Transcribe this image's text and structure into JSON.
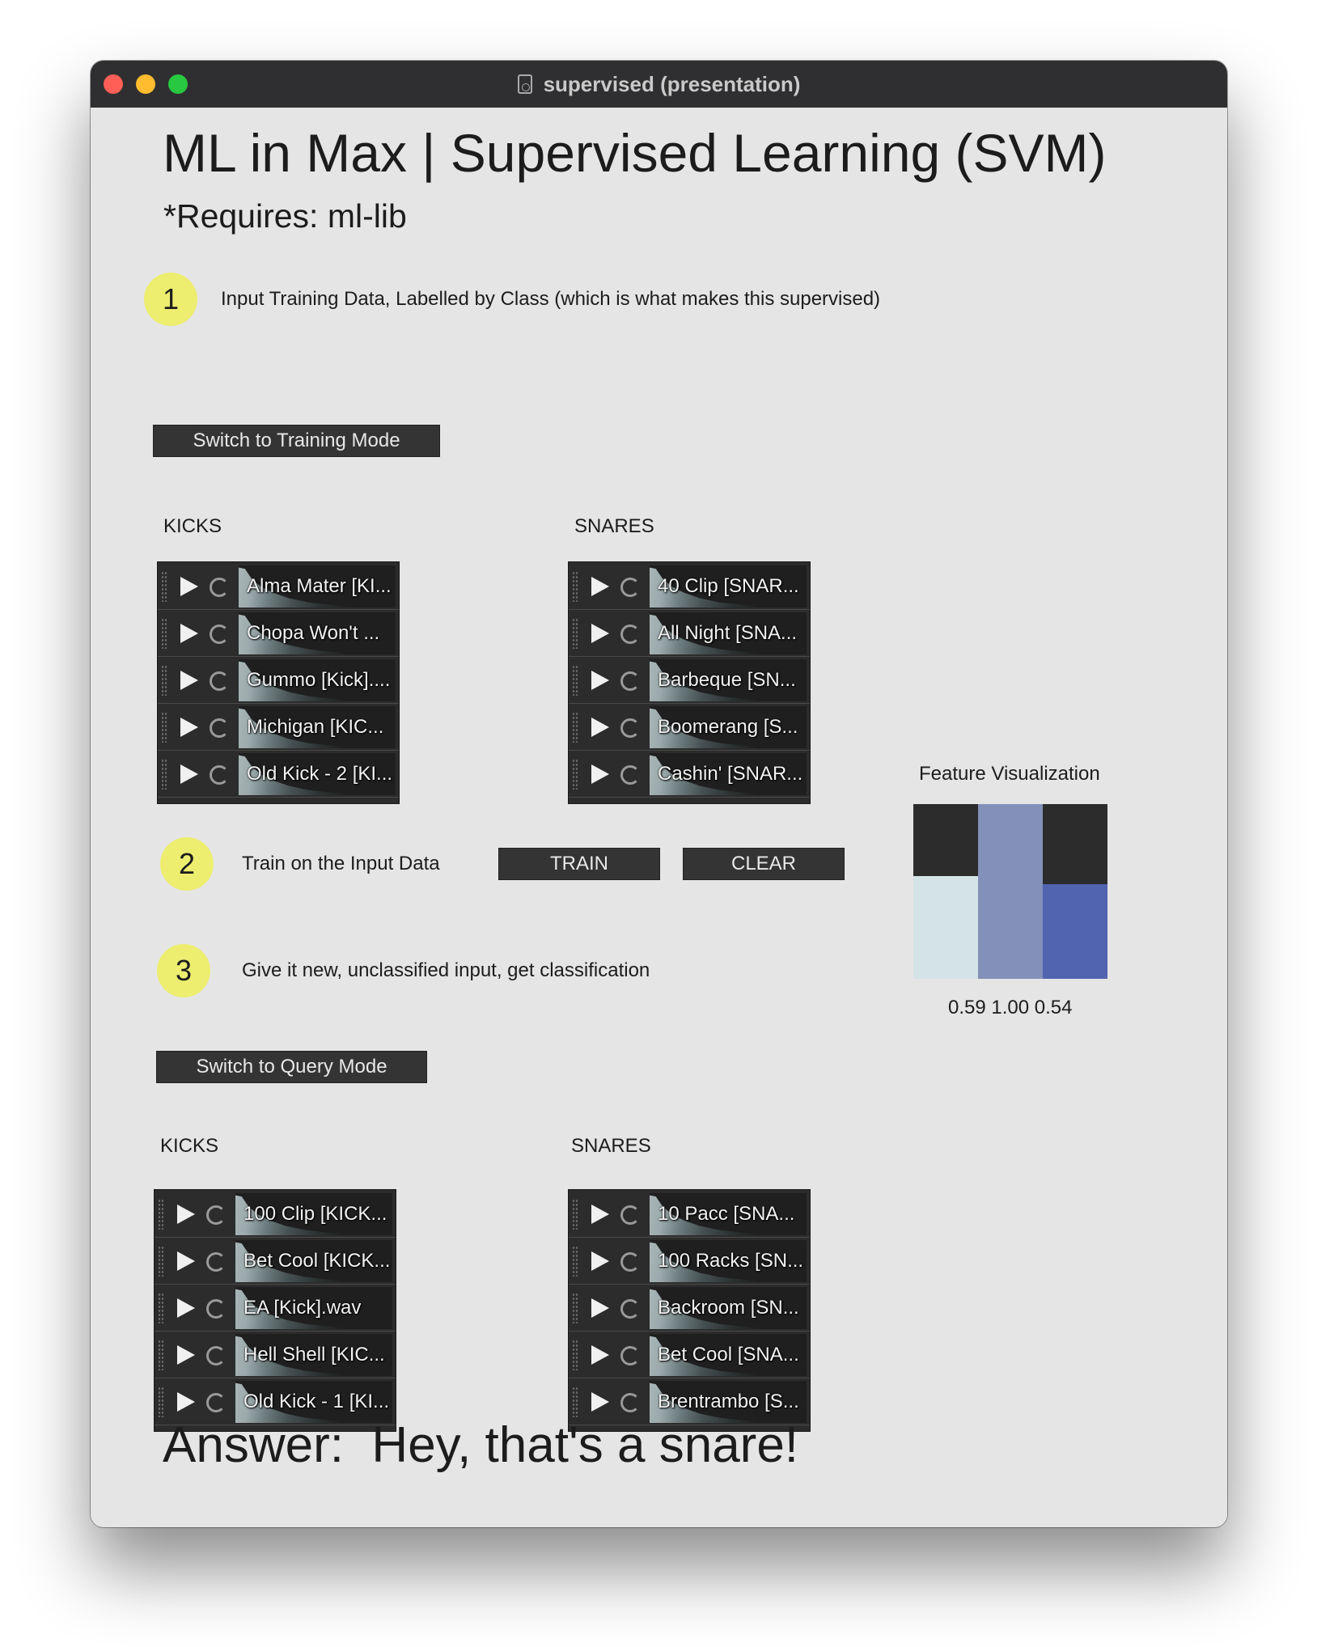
{
  "window": {
    "title": "supervised (presentation)"
  },
  "header": {
    "title": "ML in Max | Supervised Learning (SVM)",
    "requires": "*Requires: ml-lib"
  },
  "steps": [
    {
      "number": "1",
      "text": "Input Training Data, Labelled by Class (which is what makes this supervised)"
    },
    {
      "number": "2",
      "text": "Train on the Input Data"
    },
    {
      "number": "3",
      "text": "Give it new, unclassified input, get classification"
    }
  ],
  "buttons": {
    "training_mode": "Switch to Training Mode",
    "train": "TRAIN",
    "clear": "CLEAR",
    "query_mode": "Switch to Query Mode"
  },
  "training": {
    "kicks_label": "KICKS",
    "snares_label": "SNARES",
    "kicks": [
      "Alma Mater [KI...",
      "Chopa Won't ...",
      "Gummo [Kick]....",
      "Michigan [KIC...",
      "Old Kick - 2 [KI..."
    ],
    "snares": [
      "40 Clip [SNAR...",
      "All Night [SNA...",
      "Barbeque [SN...",
      "Boomerang [S...",
      "Cashin' [SNAR..."
    ]
  },
  "query": {
    "kicks_label": "KICKS",
    "snares_label": "SNARES",
    "kicks": [
      "100 Clip [KICK...",
      "Bet Cool [KICK...",
      "EA [Kick].wav",
      "Hell Shell [KIC...",
      "Old Kick - 1 [KI..."
    ],
    "snares": [
      "10 Pacc [SNA...",
      "100 Racks [SN...",
      "Backroom [SN...",
      "Bet Cool [SNA...",
      "Brentrambo [S..."
    ]
  },
  "feature_visualization": {
    "title": "Feature Visualization",
    "values": [
      0.59,
      1.0,
      0.54
    ],
    "colors": [
      "#d3e3e6",
      "#8390b9",
      "#5164b0"
    ],
    "readout": "0.59 1.00 0.54"
  },
  "answer": {
    "label": "Answer:",
    "text": "Hey, that's a snare!"
  }
}
